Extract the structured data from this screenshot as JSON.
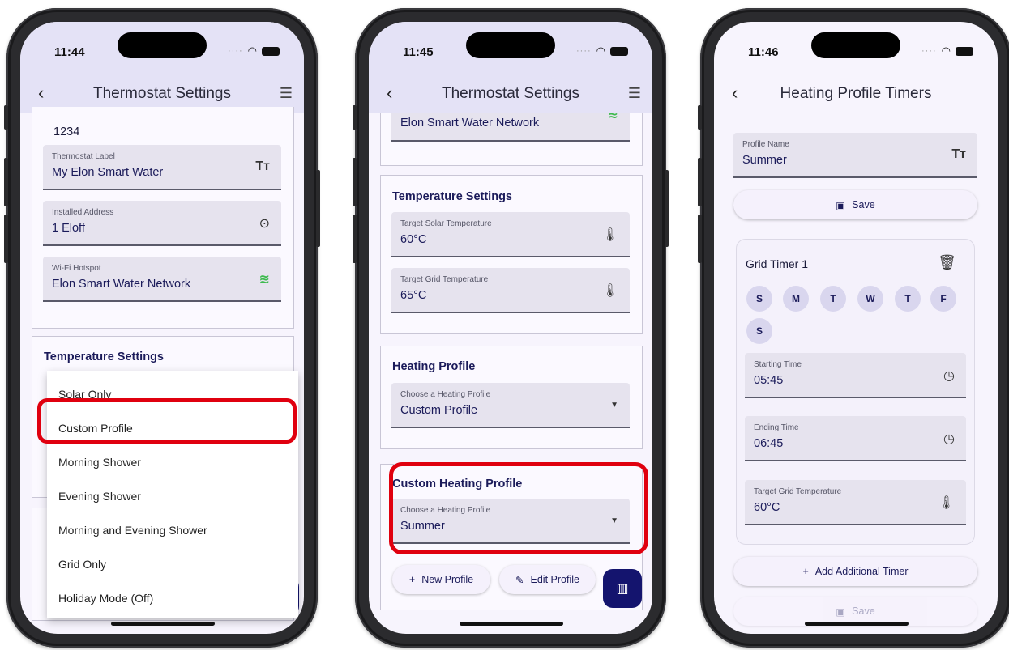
{
  "colors": {
    "accent": "#14146e",
    "highlight": "#e0000f",
    "appbar": "#e4e2f6",
    "wifi": "#3dba4e"
  },
  "screen1": {
    "time": "11:44",
    "title": "Thermostat Settings",
    "partial_value": "1234",
    "fields": [
      {
        "label": "Thermostat Label",
        "value": "My Elon Smart Water",
        "icon": "text-icon"
      },
      {
        "label": "Installed Address",
        "value": "1 Eloff",
        "icon": "location-pin-icon"
      },
      {
        "label": "Wi-Fi Hotspot",
        "value": "Elon Smart Water Network",
        "icon": "wifi-icon"
      }
    ],
    "temperature_title": "Temperature Settings",
    "dropdown_options": [
      "Solar Only",
      "Custom Profile",
      "Morning Shower",
      "Evening Shower",
      "Morning and Evening Shower",
      "Grid Only",
      "Holiday Mode (Off)"
    ],
    "highlighted_option": "Custom Profile"
  },
  "screen2": {
    "time": "11:45",
    "title": "Thermostat Settings",
    "wifi_value": "Elon Smart Water Network",
    "temperature_title": "Temperature Settings",
    "solar_label": "Target Solar Temperature",
    "solar_value": "60°C",
    "grid_label": "Target Grid Temperature",
    "grid_value": "65°C",
    "heating_title": "Heating Profile",
    "heating_label": "Choose a Heating Profile",
    "heating_value": "Custom Profile",
    "custom_title": "Custom Heating Profile",
    "custom_label": "Choose a Heating Profile",
    "custom_value": "Summer",
    "new_profile": "New Profile",
    "edit_profile": "Edit Profile"
  },
  "screen3": {
    "time": "11:46",
    "title": "Heating Profile Timers",
    "profile_name_label": "Profile Name",
    "profile_name_value": "Summer",
    "save": "Save",
    "timer_title": "Grid Timer 1",
    "days": [
      "S",
      "M",
      "T",
      "W",
      "T",
      "F",
      "S"
    ],
    "start_label": "Starting Time",
    "start_value": "05:45",
    "end_label": "Ending Time",
    "end_value": "06:45",
    "target_label": "Target Grid Temperature",
    "target_value": "60°C",
    "add_timer": "Add Additional Timer",
    "save_bottom": "Save"
  }
}
